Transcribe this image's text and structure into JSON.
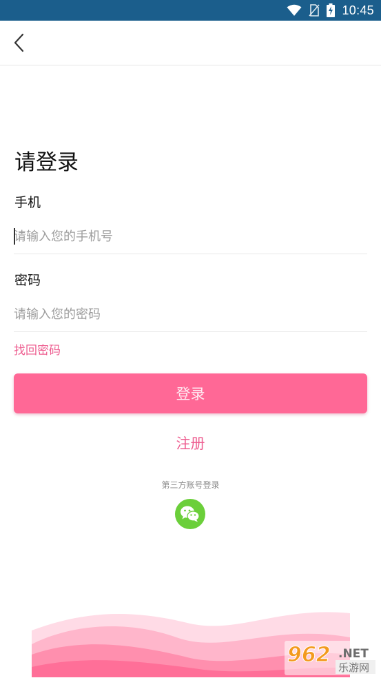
{
  "status_bar": {
    "time": "10:45",
    "icons": [
      "wifi-icon",
      "no-sim-icon",
      "battery-charging-icon"
    ]
  },
  "nav": {
    "back_icon": "chevron-left-icon"
  },
  "form": {
    "title": "请登录",
    "phone_label": "手机",
    "phone_placeholder": "请输入您的手机号",
    "password_label": "密码",
    "password_placeholder": "请输入您的密码",
    "forgot_password": "找回密码",
    "login_button": "登录",
    "register_link": "注册",
    "third_party_label": "第三方账号登录",
    "wechat_icon": "wechat-icon"
  },
  "watermark": {
    "number": "962",
    "suffix": ".NET",
    "site": "乐游网"
  },
  "colors": {
    "status_bar": "#1b5e8c",
    "accent": "#ff6896",
    "link": "#ee5f91",
    "wechat": "#6bcf3a"
  }
}
